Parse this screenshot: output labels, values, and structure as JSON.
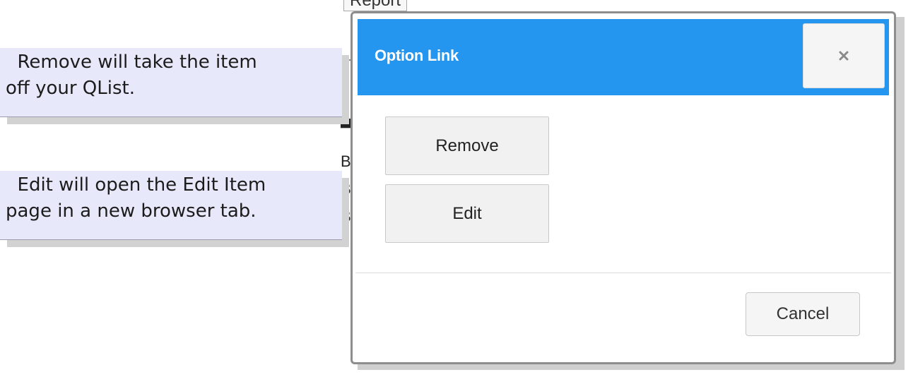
{
  "callouts": {
    "remove": "  Remove will take the item\noff your QList.",
    "edit": "  Edit will open the Edit Item\npage in a new browser tab."
  },
  "background": {
    "report_tab": "Report",
    "fragments": [
      "B",
      "B",
      "B"
    ]
  },
  "modal": {
    "title": "Option Link",
    "close_icon": "close-icon",
    "options": {
      "remove_label": "Remove",
      "edit_label": "Edit"
    },
    "cancel_label": "Cancel"
  },
  "colors": {
    "header_blue": "#2596ef",
    "callout_bg": "#e8e8fb"
  }
}
